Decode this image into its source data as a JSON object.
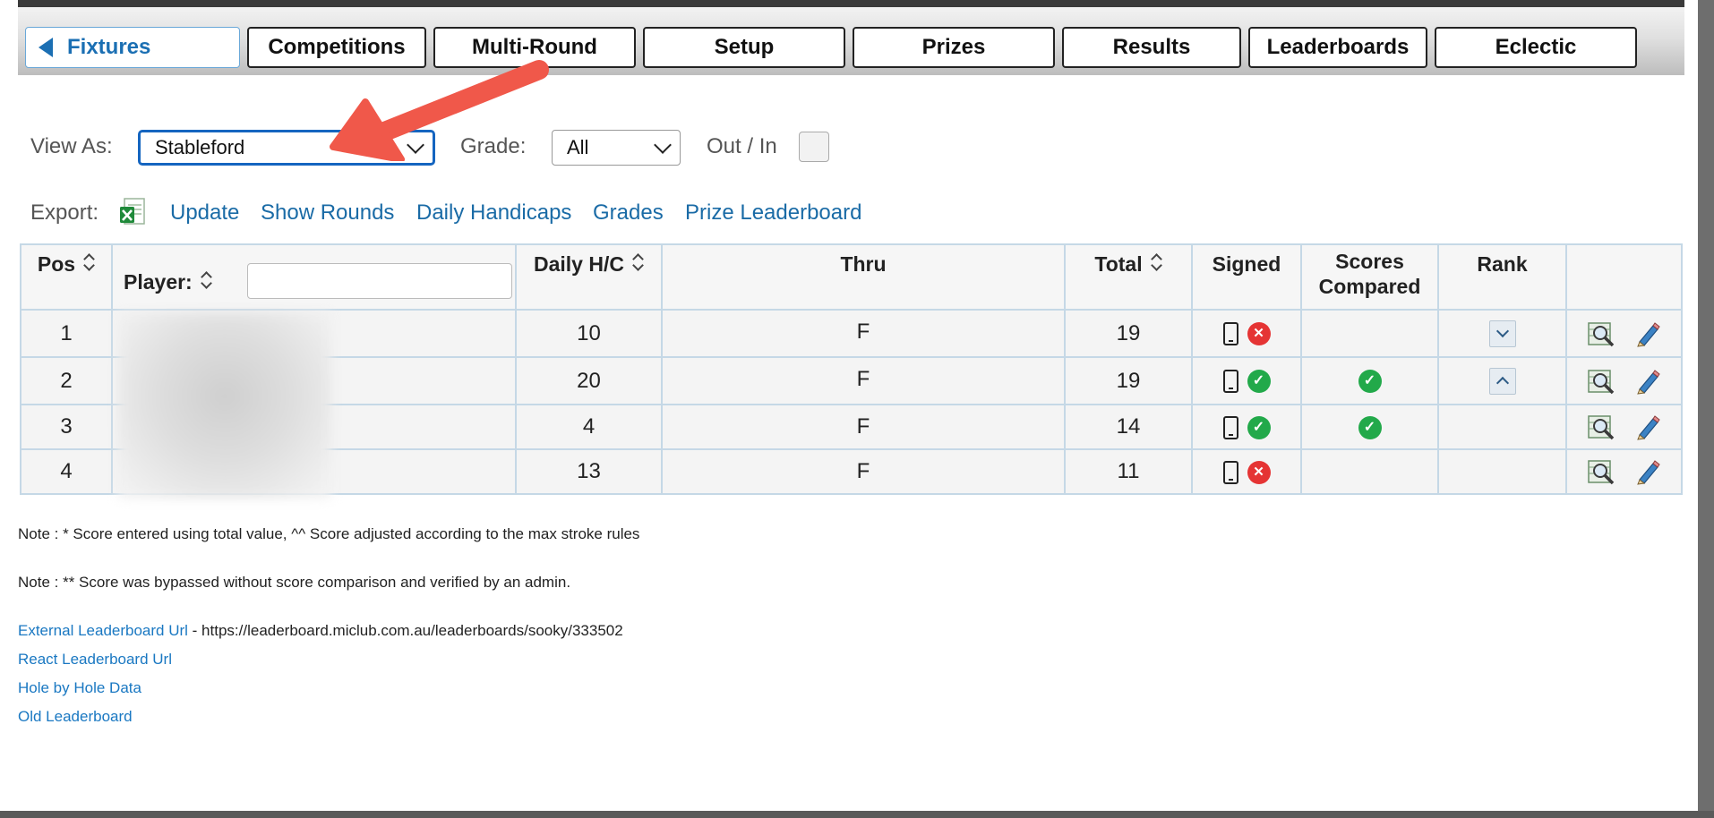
{
  "tabs": [
    {
      "label": "Fixtures",
      "active": true
    },
    {
      "label": "Competitions"
    },
    {
      "label": "Multi-Round"
    },
    {
      "label": "Setup"
    },
    {
      "label": "Prizes"
    },
    {
      "label": "Results"
    },
    {
      "label": "Leaderboards"
    },
    {
      "label": "Eclectic"
    }
  ],
  "filters": {
    "view_as_label": "View As:",
    "view_as_value": "Stableford",
    "grade_label": "Grade:",
    "grade_value": "All",
    "out_in_label": "Out / In",
    "out_in_checked": false
  },
  "export": {
    "label": "Export:",
    "icon": "excel-icon",
    "links": [
      "Update",
      "Show Rounds",
      "Daily Handicaps",
      "Grades",
      "Prize Leaderboard"
    ]
  },
  "table": {
    "headers": {
      "pos": "Pos",
      "player": "Player:",
      "daily_hc": "Daily H/C",
      "thru": "Thru",
      "total": "Total",
      "signed": "Signed",
      "scores_compared_1": "Scores",
      "scores_compared_2": "Compared",
      "rank": "Rank"
    },
    "player_filter_value": "",
    "rows": [
      {
        "pos": "1",
        "player": "",
        "daily_hc": "10",
        "thru": "F",
        "total": "19",
        "signed": "not-signed",
        "compared": "",
        "rank": "down"
      },
      {
        "pos": "2",
        "player": "",
        "daily_hc": "20",
        "thru": "F",
        "total": "19",
        "signed": "signed",
        "compared": "compared",
        "rank": "up"
      },
      {
        "pos": "3",
        "player": "",
        "daily_hc": "4",
        "thru": "F",
        "total": "14",
        "signed": "signed",
        "compared": "compared",
        "rank": ""
      },
      {
        "pos": "4",
        "player": "",
        "daily_hc": "13",
        "thru": "F",
        "total": "11",
        "signed": "not-signed",
        "compared": "",
        "rank": ""
      }
    ]
  },
  "notes": [
    "Note : * Score entered using total value, ^^ Score adjusted according to the max stroke rules",
    "Note : ** Score was bypassed without score comparison and verified by an admin."
  ],
  "footer_links": {
    "external_label": "External Leaderboard Url",
    "external_url_text": " - https://leaderboard.miclub.com.au/leaderboards/sooky/333502",
    "react": "React Leaderboard Url",
    "hole_data": "Hole by Hole Data",
    "old": "Old Leaderboard"
  },
  "colors": {
    "link": "#1a6ba6",
    "annotation_arrow": "#f0584a",
    "signed_ok": "#22a94a",
    "not_signed": "#e53434"
  }
}
